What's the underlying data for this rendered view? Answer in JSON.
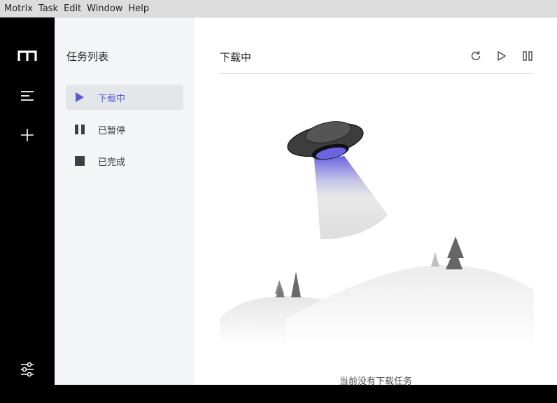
{
  "menubar": {
    "items": [
      "Motrix",
      "Task",
      "Edit",
      "Window",
      "Help"
    ]
  },
  "rail": {
    "icons": [
      "motrix-logo-icon",
      "task-list-icon",
      "add-task-icon",
      "preferences-icon"
    ]
  },
  "panel": {
    "title": "任务列表",
    "items": [
      {
        "label": "下载中",
        "icon": "play-icon",
        "active": true
      },
      {
        "label": "已暂停",
        "icon": "pause-icon",
        "active": false
      },
      {
        "label": "已完成",
        "icon": "stop-icon",
        "active": false
      }
    ]
  },
  "main": {
    "title": "下载中",
    "toolbar": [
      "refresh-icon",
      "resume-all-icon",
      "pause-all-icon"
    ],
    "empty_text": "当前没有下载任务"
  },
  "colors": {
    "accent": "#5b5bd6",
    "rail": "#000000",
    "panel_bg": "#f4f5f7"
  }
}
